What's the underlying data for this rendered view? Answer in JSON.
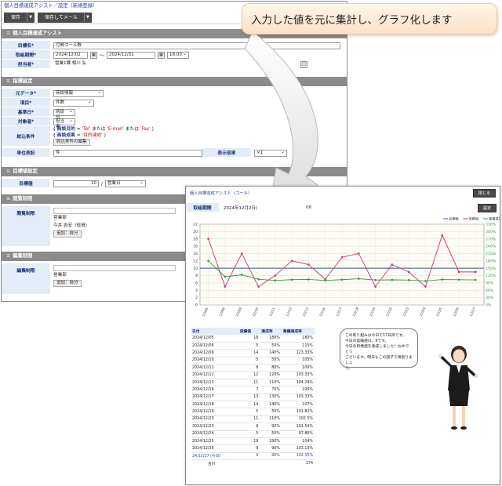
{
  "win1": {
    "breadcrumb": "個人目標達成アシスト／設定（新規登録）",
    "toolbar": {
      "save": "保存",
      "save_mail": "保存してメール"
    },
    "sec1": {
      "title": "個人目標達成アシスト",
      "name_label": "目標名*",
      "name_value": "月間コール数",
      "period_label": "取組期間*",
      "date_from": "2024/12/02",
      "tilde": "〜",
      "date_to": "2024/12/31",
      "time_to": "18:00",
      "owner_label": "担当者*",
      "owner_value": "営業1課 相川 弘"
    },
    "sec2": {
      "title": "指標設定",
      "source_label": "元データ*",
      "source_value": "商談情報",
      "item_label": "項目*",
      "item_value": "件数",
      "base_label": "基準日*",
      "base_value": "商談日",
      "target_label": "対象者*",
      "target_value": "担当者",
      "filter_label": "絞込条件",
      "filter_line1_a": "( 商談目的",
      "filter_line1_b": " = ",
      "filter_line1_c": "'Tel'",
      "filter_line1_d": " または ",
      "filter_line1_e": "'E-mail'",
      "filter_line1_f": " または ",
      "filter_line1_g": "'Fax'",
      "filter_line1_h": " )",
      "filter_line2_a": "( 商談成果",
      "filter_line2_b": " = ",
      "filter_line2_c": "'目的達成'",
      "filter_line2_d": " )",
      "filter_edit": "絞込条件の編集",
      "unit_label": "単位表記",
      "unit_value": "件",
      "mult_label": "表示倍率",
      "mult_value": "×1"
    },
    "sec3": {
      "title": "目標値設定",
      "goal_label": "目標値",
      "goal_value": "10",
      "goal_sep": "/",
      "goal_unit": "営業日"
    },
    "sec4": {
      "title": "閲覧制限",
      "label": "閲覧制限",
      "dept": "営業部",
      "person": "今井 吉宏（役員）",
      "add": "追加：自分"
    },
    "sec5": {
      "title": "編集制限",
      "label": "編集制限",
      "dept": "営業部",
      "add": "追加：自分"
    }
  },
  "win2": {
    "title": "個人目標達成アシスト（ゴール）",
    "close": "閉じる",
    "settings": "設定",
    "period_label": "取組期間",
    "period_value": "2024年12月2日(",
    "period_end": "00",
    "table": {
      "headers": [
        "日付",
        "実績値",
        "達成率",
        "業績達成率"
      ],
      "rows": [
        [
          "2024/12/05",
          "18",
          "180%",
          "180%"
        ],
        [
          "2024/12/06",
          "5",
          "50%",
          "115%"
        ],
        [
          "2024/12/09",
          "14",
          "140%",
          "123.33%"
        ],
        [
          "2024/12/10",
          "5",
          "50%",
          "105%"
        ],
        [
          "2024/12/11",
          "8",
          "80%",
          "100%"
        ],
        [
          "2024/12/12",
          "12",
          "120%",
          "103.33%"
        ],
        [
          "2024/12/13",
          "11",
          "110%",
          "104.29%"
        ],
        [
          "2024/12/16",
          "7",
          "70%",
          "100%"
        ],
        [
          "2024/12/17",
          "13",
          "130%",
          "103.33%"
        ],
        [
          "2024/12/18",
          "14",
          "140%",
          "107%"
        ],
        [
          "2024/12/19",
          "5",
          "50%",
          "101.82%"
        ],
        [
          "2024/12/20",
          "11",
          "110%",
          "102.5%"
        ],
        [
          "2024/12/23",
          "9",
          "90%",
          "101.54%"
        ],
        [
          "2024/12/24",
          "5",
          "50%",
          "97.86%"
        ],
        [
          "2024/12/25",
          "19",
          "190%",
          "104%"
        ],
        [
          "2024/12/26",
          "9",
          "90%",
          "103.13%"
        ],
        [
          "24/12/27 (今日)",
          "9",
          "90%",
          "102.35%"
        ]
      ],
      "total_label": "合計",
      "total_value": "174"
    },
    "bubble": {
      "line1": "この取り組みは今日で17日目です。",
      "line2": "今日の実績値は、9です。",
      "line3": "今日の目標値を達成しました！おめでとう",
      "line4": "ございます。明日もこの調子で頑張りましょ",
      "line5": "う。"
    }
  },
  "callout": "入力した値を元に集計し、グラフ化します",
  "chart_data": {
    "type": "line",
    "title": "",
    "legend": "top-right",
    "categories": [
      "12/05",
      "12/06",
      "12/09",
      "12/10",
      "12/11",
      "12/12",
      "12/13",
      "12/16",
      "12/17",
      "12/18",
      "12/19",
      "12/20",
      "12/23",
      "12/24",
      "12/25",
      "12/26",
      "12/27"
    ],
    "series": [
      {
        "name": "目標値",
        "color": "#3355aa",
        "values": [
          10,
          10,
          10,
          10,
          10,
          10,
          10,
          10,
          10,
          10,
          10,
          10,
          10,
          10,
          10,
          10,
          10
        ]
      },
      {
        "name": "実績値",
        "color": "#c4327a",
        "values": [
          18,
          5,
          14,
          5,
          8,
          12,
          11,
          7,
          13,
          14,
          5,
          11,
          9,
          5,
          19,
          9,
          9
        ]
      },
      {
        "name": "業績達成率",
        "color": "#2e9a3a",
        "values": [
          180,
          115,
          123.33,
          105,
          100,
          103.33,
          104.29,
          100,
          103.33,
          107,
          101.82,
          102.5,
          101.54,
          97.86,
          104,
          103.13,
          102.35
        ]
      }
    ],
    "y_left": {
      "ticks": [
        "0",
        "2",
        "4",
        "6",
        "8",
        "10",
        "12",
        "14",
        "16",
        "18",
        "20",
        "22"
      ],
      "ylim": [
        0,
        22
      ]
    },
    "y_right": {
      "ticks": [
        "0%",
        "30%",
        "60%",
        "90%",
        "120%",
        "150%",
        "180%",
        "210%",
        "240%",
        "270%",
        "300%",
        "330%"
      ],
      "ylim": [
        0,
        330
      ]
    },
    "grid": true
  }
}
